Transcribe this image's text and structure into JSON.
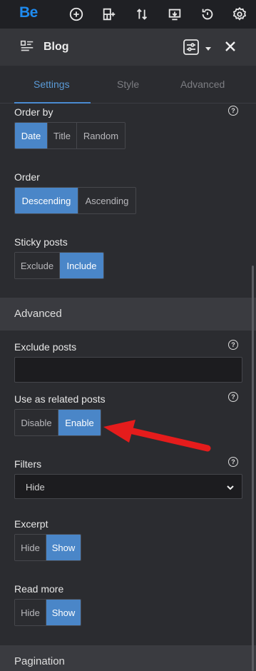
{
  "app": {
    "logo": "Be"
  },
  "toolbar": {
    "icons": [
      "add-circle-icon",
      "layout-add-icon",
      "sort-arrows-icon",
      "import-icon",
      "history-icon",
      "gear-icon"
    ]
  },
  "panel": {
    "title": "Blog",
    "icon": "blog-list-icon"
  },
  "tabs": [
    {
      "label": "Settings",
      "active": true
    },
    {
      "label": "Style",
      "active": false
    },
    {
      "label": "Advanced",
      "active": false
    }
  ],
  "order_by": {
    "label": "Order by",
    "help": "?",
    "options": [
      "Date",
      "Title",
      "Random"
    ],
    "selected": "Date"
  },
  "order": {
    "label": "Order",
    "options": [
      "Descending",
      "Ascending"
    ],
    "selected": "Descending"
  },
  "sticky_posts": {
    "label": "Sticky posts",
    "options": [
      "Exclude",
      "Include"
    ],
    "selected": "Include"
  },
  "advanced_section": {
    "title": "Advanced"
  },
  "exclude_posts": {
    "label": "Exclude posts",
    "help": "?",
    "value": ""
  },
  "related_posts": {
    "label": "Use as related posts",
    "help": "?",
    "options": [
      "Disable",
      "Enable"
    ],
    "selected": "Enable"
  },
  "filters": {
    "label": "Filters",
    "help": "?",
    "value": "Hide"
  },
  "excerpt": {
    "label": "Excerpt",
    "options": [
      "Hide",
      "Show"
    ],
    "selected": "Show"
  },
  "read_more": {
    "label": "Read more",
    "options": [
      "Hide",
      "Show"
    ],
    "selected": "Show"
  },
  "pagination_section": {
    "title": "Pagination"
  },
  "colors": {
    "accent": "#4a86c8",
    "logo": "#1e8bf0",
    "annotation_arrow": "#e51c1c"
  }
}
